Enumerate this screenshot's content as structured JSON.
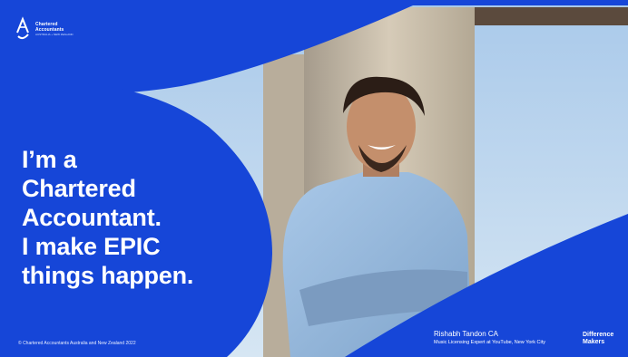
{
  "brand": {
    "logo_line1": "Chartered",
    "logo_line2": "Accountants",
    "logo_sub": "AUSTRALIA + NEW ZEALAND",
    "logo_icon": "ca-monogram-icon"
  },
  "headline": {
    "line1": "I’m a",
    "line2": "Chartered",
    "line3": "Accountant.",
    "line4": "I make EPIC",
    "line5": "things happen."
  },
  "footer": {
    "copyright": "© Chartered Accountants Australia and New Zealand 2022"
  },
  "person": {
    "name": "Rishabh Tandon CA",
    "role": "Music Licensing Expert at YouTube, New York City"
  },
  "campaign": {
    "line1": "Difference",
    "line2": "Makers"
  },
  "colors": {
    "brand_blue": "#1646d8",
    "sky": "#bcd6ee",
    "accent_pink": "#ff5a82"
  }
}
